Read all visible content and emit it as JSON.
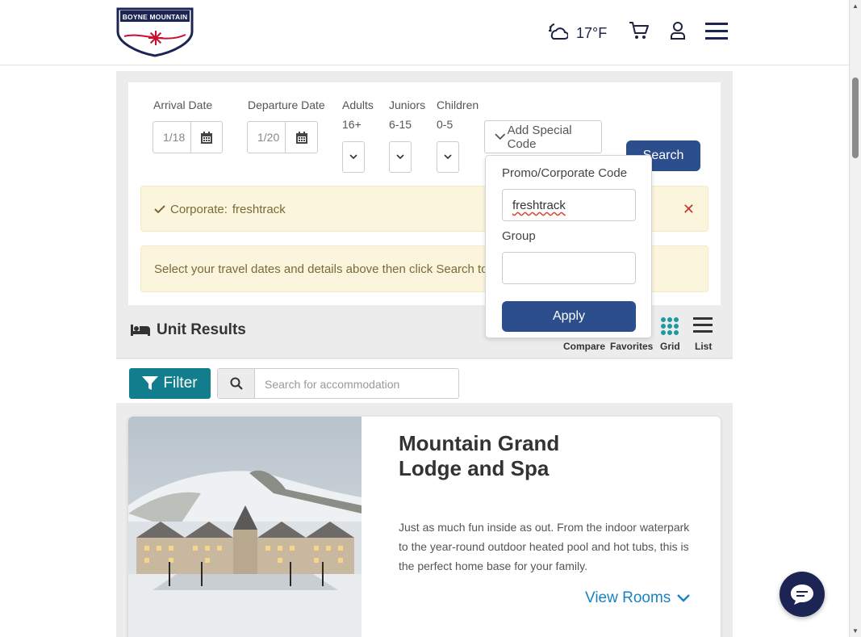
{
  "header": {
    "logo_text": "BOYNE MOUNTAIN",
    "weather_temp": "17°F",
    "icons": [
      "weather-icon",
      "cart-icon",
      "user-icon",
      "menu-icon"
    ]
  },
  "booking": {
    "arrival_label": "Arrival Date",
    "arrival_value": "1/18",
    "departure_label": "Departure Date",
    "departure_value": "1/20",
    "adults_label": "Adults",
    "adults_range": "16+",
    "juniors_label": "Juniors",
    "juniors_range": "6-15",
    "children_label": "Children",
    "children_range": "0-5",
    "special_code_label": "Add Special Code",
    "search_label": "Search"
  },
  "alerts": {
    "corporate_prefix": "Corporate:",
    "corporate_code": "freshtrack",
    "info": "Select your travel dates and details above then click Search to"
  },
  "popover": {
    "promo_label": "Promo/Corporate Code",
    "promo_value": "freshtrack",
    "group_label": "Group",
    "group_value": "",
    "apply_label": "Apply"
  },
  "results": {
    "title": "Unit Results",
    "compare_label": "Compare",
    "favorites_label": "Favorites",
    "grid_label": "Grid",
    "list_label": "List"
  },
  "filter": {
    "filter_label": "Filter",
    "search_placeholder": "Search for accommodation"
  },
  "card": {
    "title_line1": "Mountain Grand",
    "title_line2": "Lodge and Spa",
    "description": "Just as much fun inside as out. From the indoor waterpark to the year-round outdoor heated pool and hot tubs, this is the perfect home base for your family.",
    "view_rooms": "View Rooms"
  },
  "colors": {
    "primary_button": "#2c4e8c",
    "filter_button": "#127d8c",
    "link": "#1a82c4",
    "alert_bg": "#fcf5dd",
    "brand_navy": "#1c2454"
  }
}
